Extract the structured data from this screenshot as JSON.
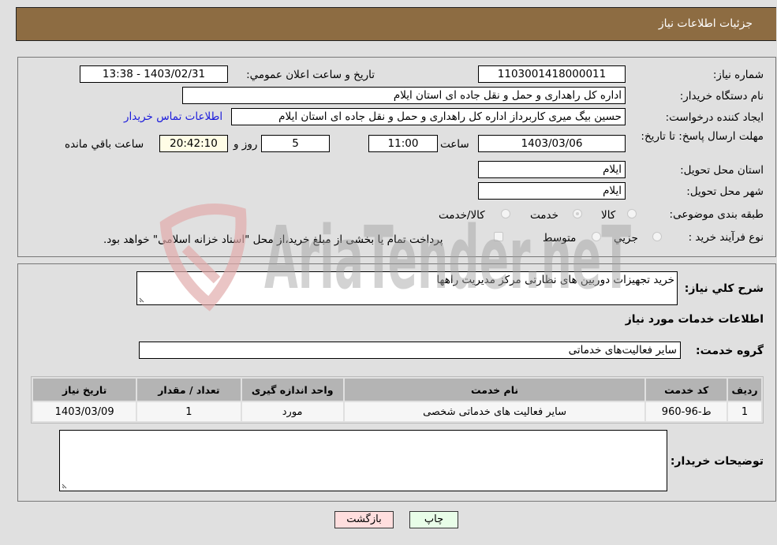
{
  "header": {
    "title": "جزئیات اطلاعات نیاز"
  },
  "form": {
    "need_number": {
      "label": "شماره نیاز:",
      "value": "1103001418000011"
    },
    "announce_datetime": {
      "label": "تاریخ و ساعت اعلان عمومي:",
      "value": "1403/02/31 - 13:38"
    },
    "buyer_org": {
      "label": "نام دستگاه خریدار:",
      "value": "اداره کل راهداری و حمل و نقل جاده ای استان ایلام"
    },
    "requester": {
      "label": "ایجاد کننده درخواست:",
      "value": "حسین بیگ میری کاربرداز اداره کل راهداری و حمل و نقل جاده ای استان ایلام",
      "contact_link": "اطلاعات تماس خریدار"
    },
    "deadline": {
      "label": "مهلت ارسال پاسخ: تا تاریخ:",
      "date": "1403/03/06",
      "time_label": "ساعت",
      "time": "11:00",
      "days": "5",
      "days_label": "روز و",
      "remaining": "20:42:10",
      "remaining_label": "ساعت باقي مانده"
    },
    "province": {
      "label": "استان محل تحویل:",
      "value": "ایلام"
    },
    "city": {
      "label": "شهر محل تحویل:",
      "value": "ایلام"
    },
    "category": {
      "label": "طبقه بندی موضوعی:",
      "options": [
        "کالا",
        "خدمت",
        "کالا/خدمت"
      ],
      "selected": "خدمت"
    },
    "process": {
      "label": "نوع فرآیند خرید :",
      "options": [
        "جزيي",
        "متوسط"
      ],
      "treasury_note": "پرداخت تمام یا بخشی از مبلغ خرید،از محل \"اسناد خزانه اسلامی\" خواهد بود."
    }
  },
  "details": {
    "summary_label": "شرح کلي نیاز:",
    "summary_value": "خرید تجهیزات دوربین های نظارتی مرکز مدیریت راهها",
    "services_title": "اطلاعات خدمات مورد نیاز",
    "service_group_label": "گروه خدمت:",
    "service_group_value": "سایر فعالیت‌های خدماتی",
    "table": {
      "headers": [
        "ردیف",
        "کد خدمت",
        "نام خدمت",
        "واحد اندازه گیری",
        "تعداد / مقدار",
        "تاریخ نیاز"
      ],
      "rows": [
        [
          "1",
          "ط-96-960",
          "سایر فعالیت های خدماتی شخصی",
          "مورد",
          "1",
          "1403/03/09"
        ]
      ]
    },
    "buyer_notes_label": "توضیحات خریدار:",
    "buyer_notes_value": ""
  },
  "actions": {
    "print": "چاپ",
    "back": "بازگشت"
  },
  "watermark": {
    "text": "AriaTender.neT"
  },
  "colors": {
    "header_bg": "#8d6c42",
    "print_bg": "#e8fde8",
    "back_bg": "#ffdede",
    "link": "#1a1adc"
  }
}
